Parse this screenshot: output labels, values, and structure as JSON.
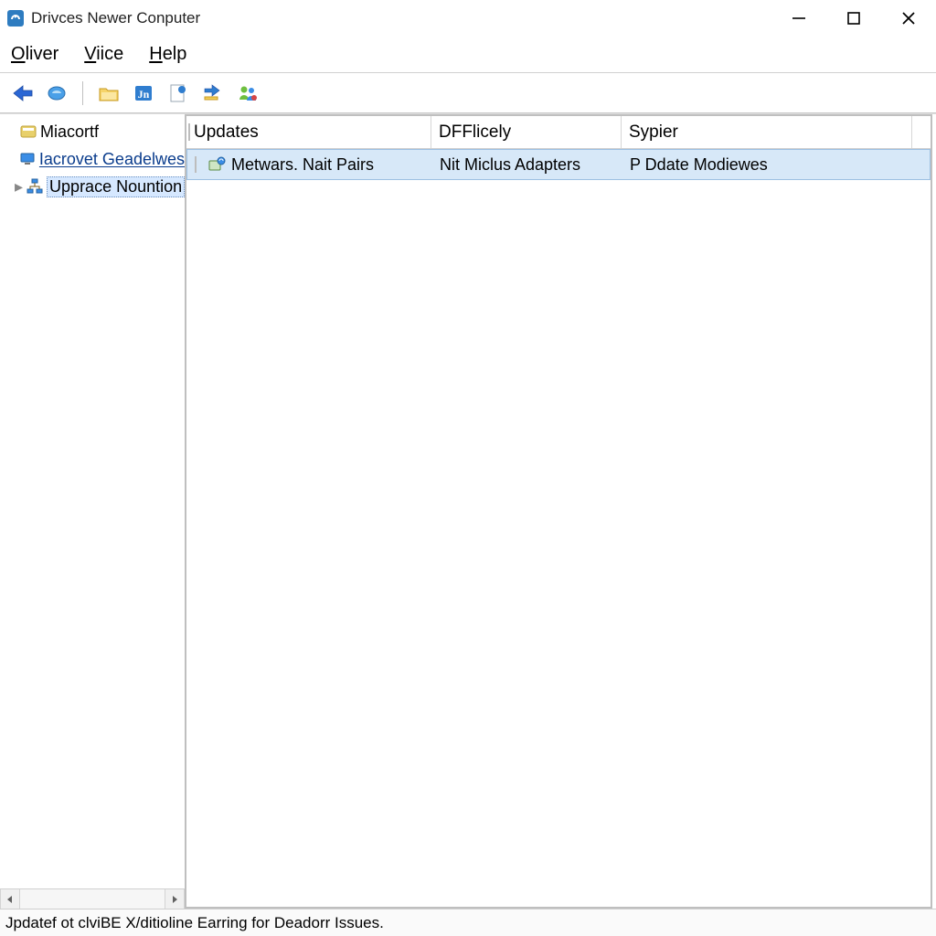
{
  "window": {
    "title": "Drivces Newer Conputer"
  },
  "menubar": [
    {
      "label": "Oliver",
      "mnemonic_index": 0
    },
    {
      "label": "Viice",
      "mnemonic_index": 0
    },
    {
      "label": "Help",
      "mnemonic_index": 0
    }
  ],
  "tree": {
    "items": [
      {
        "label": "Miacortf",
        "link": false,
        "selected": false,
        "indent": 0,
        "icon": "app",
        "expander": null
      },
      {
        "label": "Iacrovet Geadelwes",
        "link": true,
        "selected": false,
        "indent": 0,
        "icon": "monitor",
        "expander": null
      },
      {
        "label": "Upprace Nountion",
        "link": false,
        "selected": true,
        "indent": 1,
        "icon": "hier",
        "expander": "right"
      }
    ]
  },
  "list": {
    "columns": [
      "Updates",
      "DFFlicely",
      "Sypier"
    ],
    "rows": [
      {
        "c1": "Metwars. Nait Pairs",
        "c2": "Nit Miclus Adapters",
        "c3": "P Ddate Modiewes",
        "selected": true
      }
    ]
  },
  "statusbar": {
    "text": "Jpdatef ot clviBE X/ditioline Earring for Deadorr Issues."
  },
  "colors": {
    "selection_bg": "#d7e8f8",
    "selection_border": "#9cc0e2",
    "tree_selection_bg": "#d6e8ff"
  }
}
